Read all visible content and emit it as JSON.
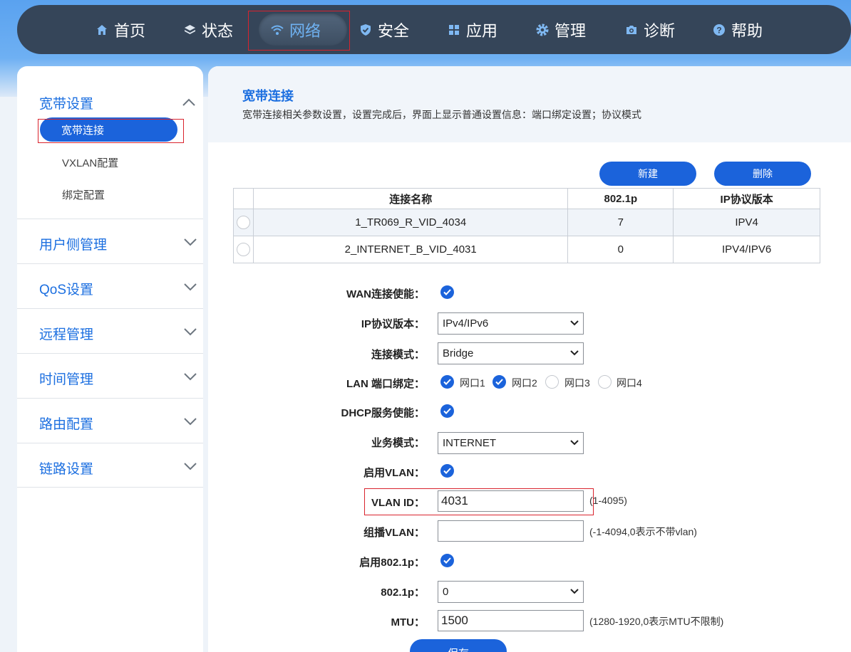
{
  "nav": {
    "items": [
      {
        "label": "首页",
        "icon": "home-icon"
      },
      {
        "label": "状态",
        "icon": "layers-icon"
      },
      {
        "label": "网络",
        "icon": "wifi-icon",
        "active": true
      },
      {
        "label": "安全",
        "icon": "shield-icon"
      },
      {
        "label": "应用",
        "icon": "grid-icon"
      },
      {
        "label": "管理",
        "icon": "gear-icon"
      },
      {
        "label": "诊断",
        "icon": "camera-icon"
      },
      {
        "label": "帮助",
        "icon": "help-icon"
      }
    ]
  },
  "sidebar": {
    "section": "宽带设置",
    "subitems": [
      "宽带连接",
      "VXLAN配置",
      "绑定配置"
    ],
    "groups": [
      "用户侧管理",
      "QoS设置",
      "远程管理",
      "时间管理",
      "路由配置",
      "链路设置"
    ]
  },
  "main": {
    "title": "宽带连接",
    "desc": "宽带连接相关参数设置，设置完成后，界面上显示普通设置信息：端口绑定设置；协议模式",
    "new_label": "新建",
    "delete_label": "删除",
    "table": {
      "headers": [
        "连接名称",
        "802.1p",
        "IP协议版本"
      ],
      "rows": [
        [
          "1_TR069_R_VID_4034",
          "7",
          "IPV4"
        ],
        [
          "2_INTERNET_B_VID_4031",
          "0",
          "IPV4/IPV6"
        ]
      ]
    },
    "form": {
      "wan_enable_label": "WAN连接使能：",
      "ip_version_label": "IP协议版本：",
      "ip_version_value": "IPv4/IPv6",
      "conn_mode_label": "连接模式：",
      "conn_mode_value": "Bridge",
      "lan_bind_label": "LAN 端口绑定：",
      "ports": [
        "网口1",
        "网口2",
        "网口3",
        "网口4"
      ],
      "dhcp_label": "DHCP服务使能：",
      "service_label": "业务模式：",
      "service_value": "INTERNET",
      "vlan_enable_label": "启用VLAN：",
      "vlan_id_label": "VLAN ID：",
      "vlan_id_value": "4031",
      "vlan_id_hint": "(1-4095)",
      "mcast_label": "组播VLAN：",
      "mcast_value": "",
      "mcast_hint": "(-1-4094,0表示不带vlan)",
      "p_enable_label": "启用802.1p：",
      "p_label": "802.1p：",
      "p_value": "0",
      "mtu_label": "MTU：",
      "mtu_value": "1500",
      "mtu_hint": "(1280-1920,0表示MTU不限制)",
      "save_label": "保存"
    }
  }
}
